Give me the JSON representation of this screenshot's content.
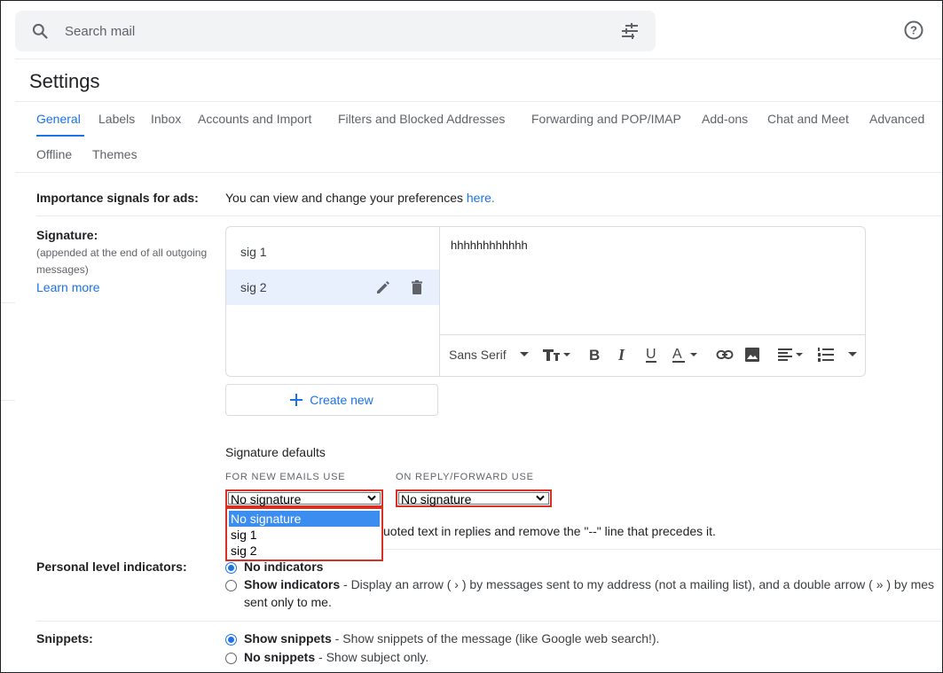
{
  "search": {
    "placeholder": "Search mail"
  },
  "page_title": "Settings",
  "tabs": [
    {
      "label": "General",
      "active": true
    },
    {
      "label": "Labels"
    },
    {
      "label": "Inbox"
    },
    {
      "label": "Accounts and Import"
    },
    {
      "label": "Filters and Blocked Addresses"
    },
    {
      "label": "Forwarding and POP/IMAP"
    },
    {
      "label": "Add-ons"
    },
    {
      "label": "Chat and Meet"
    },
    {
      "label": "Advanced"
    },
    {
      "label": "Offline"
    },
    {
      "label": "Themes"
    }
  ],
  "importance": {
    "label": "Importance signals for ads:",
    "text": "You can view and change your preferences",
    "link": "here."
  },
  "signature": {
    "label": "Signature:",
    "sublabel_1": "(appended at the end of all outgoing",
    "sublabel_2": "messages)",
    "learn_more": "Learn more",
    "items": [
      "sig 1",
      "sig 2"
    ],
    "editor_text": "hhhhhhhhhhhh",
    "font": "Sans Serif",
    "create_new": "Create new",
    "defaults_title": "Signature defaults",
    "new_emails_label": "FOR NEW EMAILS USE",
    "reply_label": "ON REPLY/FORWARD USE",
    "new_emails_value": "No signature",
    "reply_value": "No signature",
    "dropdown_options": [
      "No signature",
      "sig 1",
      "sig 2"
    ],
    "insert_text": "uoted text in replies and remove the \"--\" line that precedes it."
  },
  "personal": {
    "label": "Personal level indicators:",
    "opt1": "No indicators",
    "opt2": "Show indicators",
    "opt2_desc": " - Display an arrow ( › ) by messages sent to my address (not a mailing list), and a double arrow ( » ) by mes",
    "opt2_desc2": "sent only to me."
  },
  "snippets": {
    "label": "Snippets:",
    "opt1": "Show snippets",
    "opt1_desc": " - Show snippets of the message (like Google web search!).",
    "opt2": "No snippets",
    "opt2_desc": " - Show subject only."
  },
  "colors": {
    "accent": "#1a73e8",
    "highlight_border": "#d93025",
    "selected_row": "#e8f0fe"
  }
}
